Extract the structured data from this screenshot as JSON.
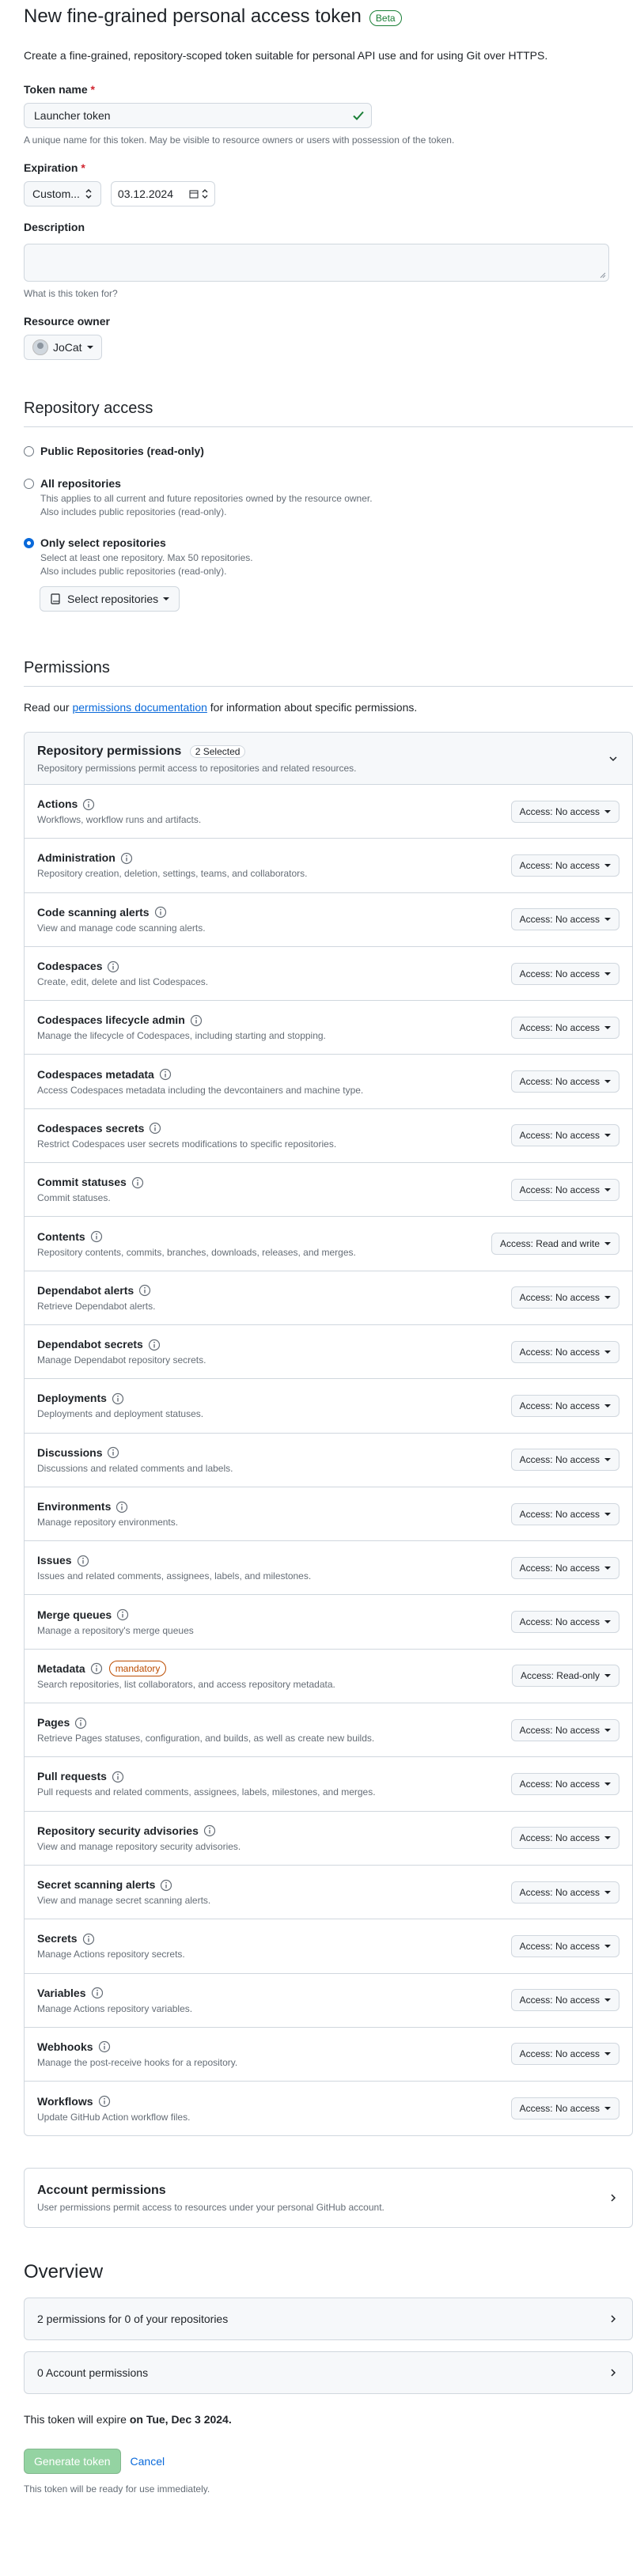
{
  "header": {
    "title": "New fine-grained personal access token",
    "badge": "Beta",
    "intro": "Create a fine-grained, repository-scoped token suitable for personal API use and for using Git over HTTPS."
  },
  "token_name": {
    "label": "Token name",
    "required_mark": "*",
    "value": "Launcher token",
    "note": "A unique name for this token. May be visible to resource owners or users with possession of the token."
  },
  "expiration": {
    "label": "Expiration",
    "required_mark": "*",
    "selected": "Custom...",
    "date": "03.12.2024"
  },
  "description": {
    "label": "Description",
    "value": "",
    "note": "What is this token for?"
  },
  "resource_owner": {
    "label": "Resource owner",
    "selected": "JoCat"
  },
  "repository_access": {
    "title": "Repository access",
    "options": [
      {
        "title": "Public Repositories (read-only)",
        "desc1": "",
        "desc2": "",
        "checked": false
      },
      {
        "title": "All repositories",
        "desc1": "This applies to all current and future repositories owned by the resource owner.",
        "desc2": "Also includes public repositories (read-only).",
        "checked": false
      },
      {
        "title": "Only select repositories",
        "desc1": "Select at least one repository. Max 50 repositories.",
        "desc2": "Also includes public repositories (read-only).",
        "checked": true
      }
    ],
    "select_button": "Select repositories"
  },
  "permissions": {
    "title": "Permissions",
    "read_prefix": "Read our ",
    "read_link": "permissions documentation",
    "read_suffix": " for information about specific permissions.",
    "repo_title": "Repository permissions",
    "repo_counter": "2 Selected",
    "repo_desc": "Repository permissions permit access to repositories and related resources.",
    "items": [
      {
        "name": "Actions",
        "desc": "Workflows, workflow runs and artifacts.",
        "access": "Access: No access",
        "mandatory": ""
      },
      {
        "name": "Administration",
        "desc": "Repository creation, deletion, settings, teams, and collaborators.",
        "access": "Access: No access",
        "mandatory": ""
      },
      {
        "name": "Code scanning alerts",
        "desc": "View and manage code scanning alerts.",
        "access": "Access: No access",
        "mandatory": ""
      },
      {
        "name": "Codespaces",
        "desc": "Create, edit, delete and list Codespaces.",
        "access": "Access: No access",
        "mandatory": ""
      },
      {
        "name": "Codespaces lifecycle admin",
        "desc": "Manage the lifecycle of Codespaces, including starting and stopping.",
        "access": "Access: No access",
        "mandatory": ""
      },
      {
        "name": "Codespaces metadata",
        "desc": "Access Codespaces metadata including the devcontainers and machine type.",
        "access": "Access: No access",
        "mandatory": ""
      },
      {
        "name": "Codespaces secrets",
        "desc": "Restrict Codespaces user secrets modifications to specific repositories.",
        "access": "Access: No access",
        "mandatory": ""
      },
      {
        "name": "Commit statuses",
        "desc": "Commit statuses.",
        "access": "Access: No access",
        "mandatory": ""
      },
      {
        "name": "Contents",
        "desc": "Repository contents, commits, branches, downloads, releases, and merges.",
        "access": "Access: Read and write",
        "mandatory": ""
      },
      {
        "name": "Dependabot alerts",
        "desc": "Retrieve Dependabot alerts.",
        "access": "Access: No access",
        "mandatory": ""
      },
      {
        "name": "Dependabot secrets",
        "desc": "Manage Dependabot repository secrets.",
        "access": "Access: No access",
        "mandatory": ""
      },
      {
        "name": "Deployments",
        "desc": "Deployments and deployment statuses.",
        "access": "Access: No access",
        "mandatory": ""
      },
      {
        "name": "Discussions",
        "desc": "Discussions and related comments and labels.",
        "access": "Access: No access",
        "mandatory": ""
      },
      {
        "name": "Environments",
        "desc": "Manage repository environments.",
        "access": "Access: No access",
        "mandatory": ""
      },
      {
        "name": "Issues",
        "desc": "Issues and related comments, assignees, labels, and milestones.",
        "access": "Access: No access",
        "mandatory": ""
      },
      {
        "name": "Merge queues",
        "desc": "Manage a repository's merge queues",
        "access": "Access: No access",
        "mandatory": ""
      },
      {
        "name": "Metadata",
        "desc": "Search repositories, list collaborators, and access repository metadata.",
        "access": "Access: Read-only",
        "mandatory": "mandatory"
      },
      {
        "name": "Pages",
        "desc": "Retrieve Pages statuses, configuration, and builds, as well as create new builds.",
        "access": "Access: No access",
        "mandatory": ""
      },
      {
        "name": "Pull requests",
        "desc": "Pull requests and related comments, assignees, labels, milestones, and merges.",
        "access": "Access: No access",
        "mandatory": ""
      },
      {
        "name": "Repository security advisories",
        "desc": "View and manage repository security advisories.",
        "access": "Access: No access",
        "mandatory": ""
      },
      {
        "name": "Secret scanning alerts",
        "desc": "View and manage secret scanning alerts.",
        "access": "Access: No access",
        "mandatory": ""
      },
      {
        "name": "Secrets",
        "desc": "Manage Actions repository secrets.",
        "access": "Access: No access",
        "mandatory": ""
      },
      {
        "name": "Variables",
        "desc": "Manage Actions repository variables.",
        "access": "Access: No access",
        "mandatory": ""
      },
      {
        "name": "Webhooks",
        "desc": "Manage the post-receive hooks for a repository.",
        "access": "Access: No access",
        "mandatory": ""
      },
      {
        "name": "Workflows",
        "desc": "Update GitHub Action workflow files.",
        "access": "Access: No access",
        "mandatory": ""
      }
    ],
    "account_title": "Account permissions",
    "account_desc": "User permissions permit access to resources under your personal GitHub account."
  },
  "overview": {
    "title": "Overview",
    "items": [
      "2 permissions for 0 of your repositories",
      "0 Account permissions"
    ],
    "expire_prefix": "This token will expire ",
    "expire_date": "on Tue, Dec 3 2024.",
    "generate_label": "Generate token",
    "cancel_label": "Cancel",
    "ready_note": "This token will be ready for use immediately."
  },
  "colors": {
    "accent": "#0969da",
    "success": "#1a7f37",
    "danger": "#d1242f",
    "attention": "#bc4c00",
    "generate_disabled": "#94d3a2"
  }
}
